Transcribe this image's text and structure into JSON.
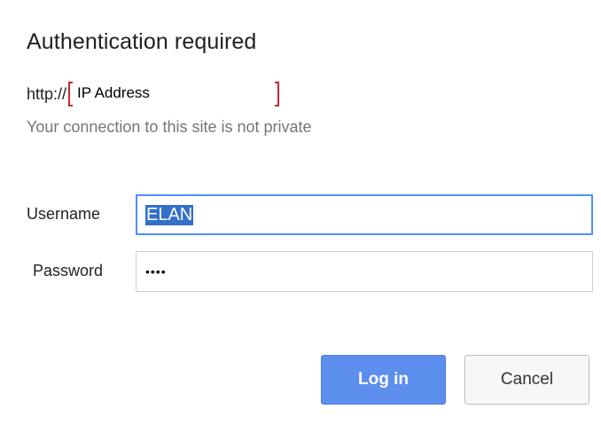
{
  "dialog": {
    "title": "Authentication required",
    "url_scheme": "http://",
    "url_host": "IP Address",
    "privacy_note": "Your connection to this site is not private"
  },
  "form": {
    "username": {
      "label": "Username",
      "value": "ELAN"
    },
    "password": {
      "label": "Password",
      "masked_value": "••••"
    }
  },
  "buttons": {
    "login_label": "Log in",
    "cancel_label": "Cancel"
  },
  "colors": {
    "primary_button": "#5b8eed",
    "focus_border": "#4d90fe",
    "redaction_marker": "#d0262d",
    "selection": "#3370c8"
  }
}
